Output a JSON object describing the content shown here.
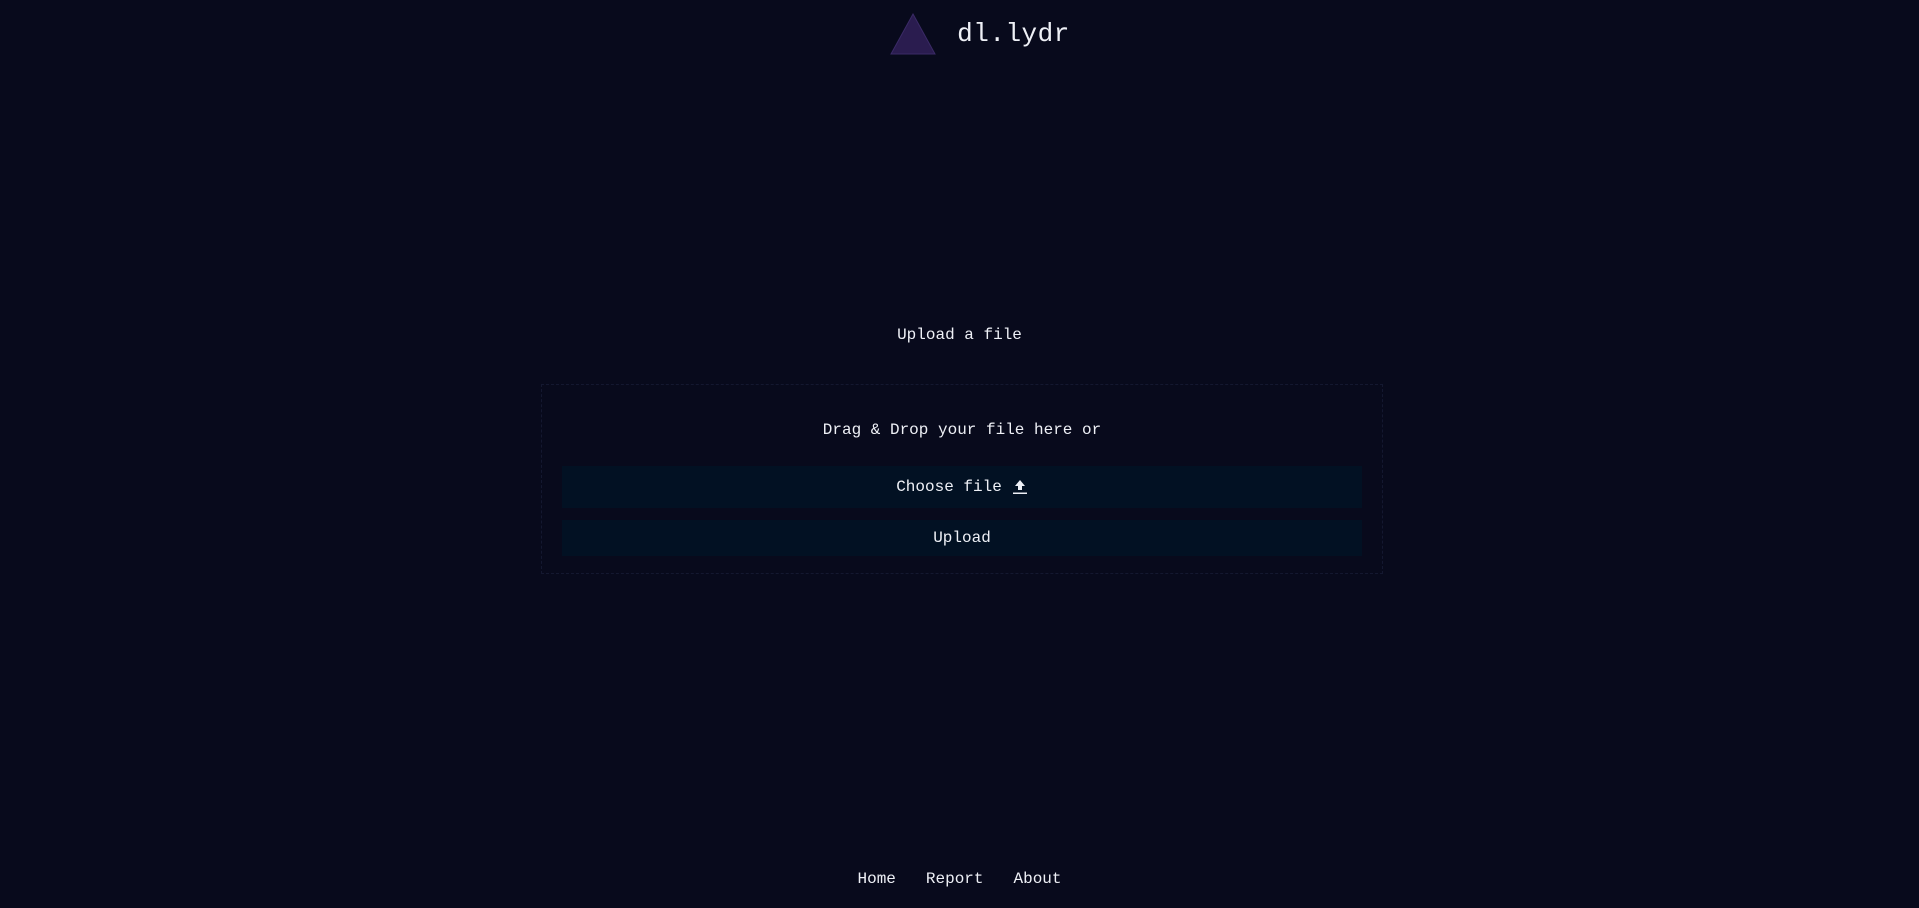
{
  "header": {
    "site_name": "dl.lydr",
    "logo_icon": "triangle-logo-icon"
  },
  "main": {
    "title": "Upload a file",
    "drop_text": "Drag & Drop your file here or",
    "choose_label": "Choose file",
    "choose_icon": "upload-arrow-icon",
    "upload_label": "Upload"
  },
  "footer": {
    "links": [
      "Home",
      "Report",
      "About"
    ]
  },
  "colors": {
    "background": "#080a1c",
    "button_bg": "#021123",
    "logo_fill": "#2a1c4f",
    "text": "#eef0f6"
  }
}
